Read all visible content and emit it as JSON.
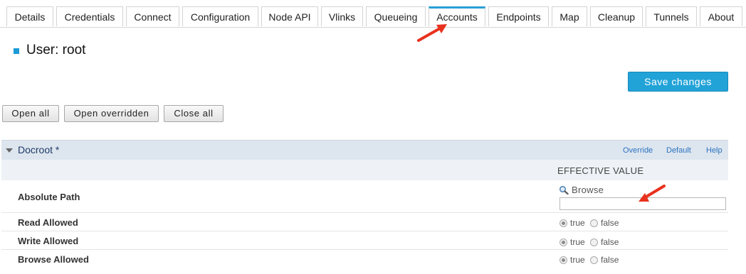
{
  "tabs": [
    {
      "label": "Details"
    },
    {
      "label": "Credentials"
    },
    {
      "label": "Connect"
    },
    {
      "label": "Configuration"
    },
    {
      "label": "Node API"
    },
    {
      "label": "Vlinks"
    },
    {
      "label": "Queueing"
    },
    {
      "label": "Accounts",
      "active": true
    },
    {
      "label": "Endpoints"
    },
    {
      "label": "Map"
    },
    {
      "label": "Cleanup"
    },
    {
      "label": "Tunnels"
    },
    {
      "label": "About"
    }
  ],
  "page": {
    "title": "User: root"
  },
  "actions": {
    "save_label": "Save changes",
    "open_all": "Open all",
    "open_overridden": "Open overridden",
    "close_all": "Close all"
  },
  "section": {
    "title": "Docroot *",
    "override": "Override",
    "default": "Default",
    "help": "Help",
    "column_header": "EFFECTIVE VALUE",
    "expanded": true
  },
  "rows": {
    "absolute_path": {
      "label": "Absolute Path",
      "browse": "Browse",
      "value": ""
    },
    "read_allowed": {
      "label": "Read Allowed",
      "true_label": "true",
      "false_label": "false",
      "value": "true"
    },
    "write_allowed": {
      "label": "Write Allowed",
      "true_label": "true",
      "false_label": "false",
      "value": "true"
    },
    "browse_allowed": {
      "label": "Browse Allowed",
      "true_label": "true",
      "false_label": "false",
      "value": "true"
    }
  },
  "colors": {
    "accent": "#22a3d8",
    "tab_active_border": "#2a9fd6",
    "section_header_bg": "#dde5ee",
    "annotation_arrow": "#e8321e"
  },
  "icons": [
    "magnifier-icon",
    "caret-down-icon",
    "annotation-arrow-icon"
  ]
}
